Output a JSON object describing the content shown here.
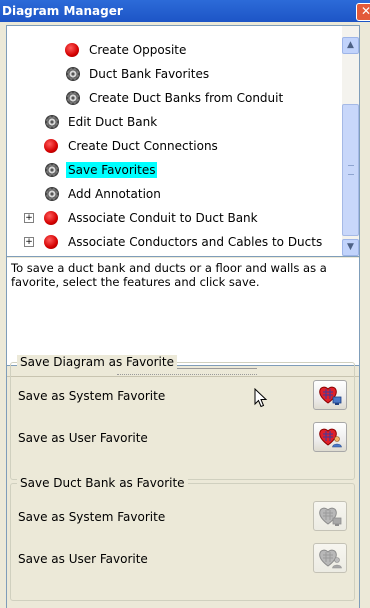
{
  "window": {
    "title": "Diagram Manager",
    "close_glyph": "✕"
  },
  "tree": {
    "items": [
      {
        "label": "Create Opposite",
        "icon": "red-circle-icon",
        "selected": false,
        "expander": ""
      },
      {
        "label": "Duct Bank Favorites",
        "icon": "gear-icon",
        "selected": false,
        "expander": ""
      },
      {
        "label": "Create Duct Banks from Conduit",
        "icon": "gear-icon",
        "selected": false,
        "expander": ""
      },
      {
        "label": "Edit Duct Bank",
        "icon": "gear-icon",
        "selected": false,
        "expander": ""
      },
      {
        "label": "Create Duct Connections",
        "icon": "red-circle-icon",
        "selected": false,
        "expander": ""
      },
      {
        "label": "Save Favorites",
        "icon": "gear-icon",
        "selected": true,
        "expander": ""
      },
      {
        "label": "Add Annotation",
        "icon": "gear-icon",
        "selected": false,
        "expander": ""
      },
      {
        "label": "Associate Conduit to Duct Bank",
        "icon": "red-circle-icon",
        "selected": false,
        "expander": "+"
      },
      {
        "label": "Associate Conductors and Cables to Ducts",
        "icon": "red-circle-icon",
        "selected": false,
        "expander": "+"
      }
    ]
  },
  "description": "To save a duct bank and ducts or a floor and walls as a favorite, select the features and click save.",
  "groups": {
    "diagram": {
      "title": "Save Diagram as Favorite",
      "system_label": "Save as System Favorite",
      "user_label": "Save as User Favorite",
      "enabled": true
    },
    "duct_bank": {
      "title": "Save Duct Bank as Favorite",
      "system_label": "Save as System Favorite",
      "user_label": "Save as User Favorite",
      "enabled": false
    }
  },
  "colors": {
    "selection_highlight": "#00ffff",
    "title_bar": "#1d55c6",
    "panel_bg": "#ece9d8",
    "red_icon": "#d40000"
  }
}
